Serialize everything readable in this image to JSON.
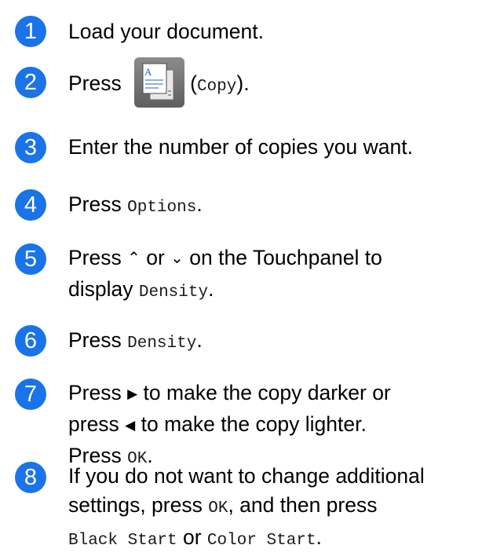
{
  "steps": [
    {
      "number": "1",
      "text": "Load your document."
    },
    {
      "number": "2",
      "pre": "Press",
      "paren_open": "(",
      "mono": "Copy",
      "paren_close": ").",
      "icon": "copy-app-icon"
    },
    {
      "number": "3",
      "text": "Enter the number of copies you want."
    },
    {
      "number": "4",
      "pre": "Press ",
      "mono": "Options",
      "post": "."
    },
    {
      "number": "5",
      "pre": "Press ",
      "up_arrow": "⌃",
      "mid": " or ",
      "down_arrow": "⌄",
      "post": " on the Touchpanel to",
      "line2_pre": "display ",
      "line2_mono": "Density",
      "line2_post": "."
    },
    {
      "number": "6",
      "pre": "Press ",
      "mono": "Density",
      "post": "."
    },
    {
      "number": "7",
      "line1_pre": "Press ",
      "right_arrow": "▶",
      "line1_post": " to make the copy darker or",
      "line2_pre": "press ",
      "left_arrow": "◀",
      "line2_post": " to make the copy lighter.",
      "line3_pre": "Press ",
      "line3_mono": "OK",
      "line3_post": "."
    },
    {
      "number": "8",
      "line1": "If you do not want to change additional",
      "line2_pre": "settings, press ",
      "line2_mono": "OK",
      "line2_post": ", and then press",
      "line3_mono1": "Black Start",
      "line3_or": " or ",
      "line3_mono2": "Color Start",
      "line3_post": "."
    }
  ],
  "colors": {
    "badge": "#1a73e8"
  }
}
